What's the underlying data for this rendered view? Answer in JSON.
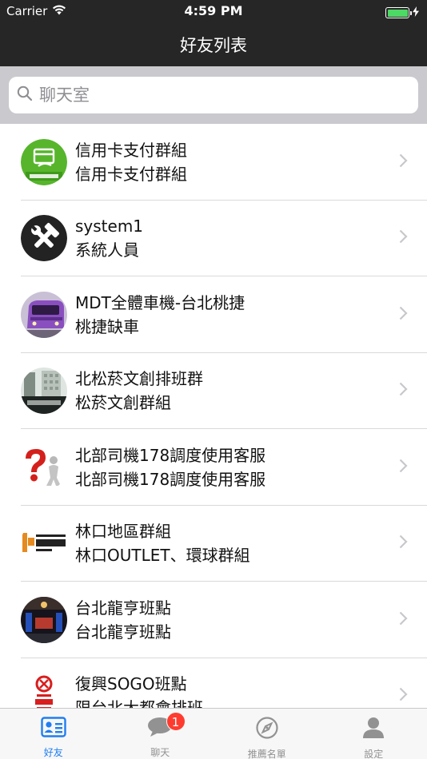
{
  "status_bar": {
    "carrier": "Carrier",
    "time": "4:59 PM",
    "battery_level": 1.0,
    "battery_color": "#4cd964"
  },
  "nav": {
    "title": "好友列表"
  },
  "search": {
    "placeholder": "聊天室",
    "value": ""
  },
  "contacts": [
    {
      "name": "信用卡支付群組",
      "subtitle": "信用卡支付群組",
      "avatar": "credit-card-group-avatar"
    },
    {
      "name": "system1",
      "subtitle": "系統人員",
      "avatar": "tools-avatar"
    },
    {
      "name": "MDT全體車機-台北桃捷",
      "subtitle": "桃捷缺車",
      "avatar": "metro-train-avatar"
    },
    {
      "name": "北松菸文創排班群",
      "subtitle": "松菸文創群組",
      "avatar": "building-photo-avatar"
    },
    {
      "name": "北部司機178調度使用客服",
      "subtitle": "北部司機178調度使用客服",
      "avatar": "question-mark-avatar"
    },
    {
      "name": "林口地區群組",
      "subtitle": "林口OUTLET、環球群組",
      "avatar": "outlet-park-avatar"
    },
    {
      "name": "台北龍亨班點",
      "subtitle": "台北龍亨班點",
      "avatar": "nightlife-photo-avatar"
    },
    {
      "name": "復興SOGO班點",
      "subtitle": "限台北大都會排班",
      "avatar": "sogo-logo-avatar"
    }
  ],
  "tabs": [
    {
      "label": "好友",
      "icon": "contacts-card-icon",
      "active": true
    },
    {
      "label": "聊天",
      "icon": "chat-bubble-icon",
      "active": false,
      "badge": "1"
    },
    {
      "label": "推薦名單",
      "icon": "compass-icon",
      "active": false
    },
    {
      "label": "設定",
      "icon": "person-icon",
      "active": false
    }
  ],
  "colors": {
    "accent": "#1e7ef2",
    "nav_background": "#262626",
    "badge": "#ff3b30"
  }
}
